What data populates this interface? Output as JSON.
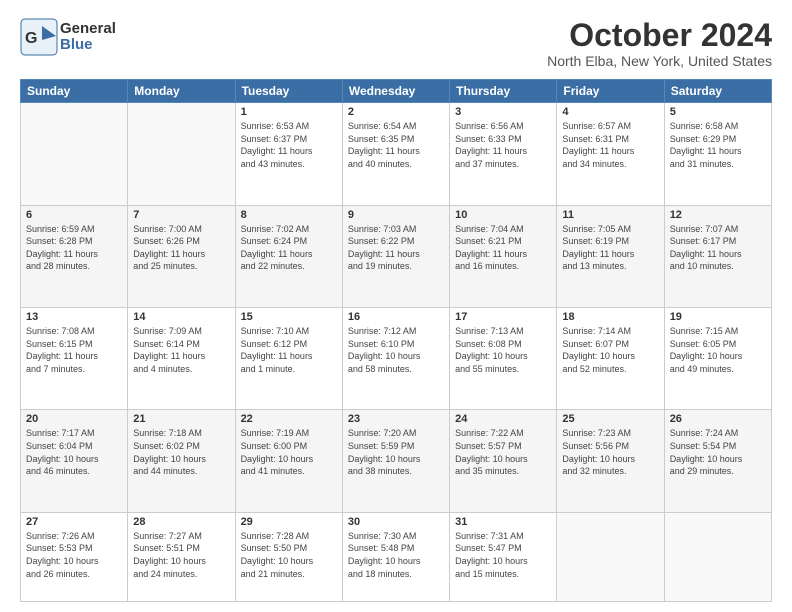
{
  "header": {
    "logo_general": "General",
    "logo_blue": "Blue",
    "month_title": "October 2024",
    "location": "North Elba, New York, United States"
  },
  "days_of_week": [
    "Sunday",
    "Monday",
    "Tuesday",
    "Wednesday",
    "Thursday",
    "Friday",
    "Saturday"
  ],
  "weeks": [
    [
      {
        "num": "",
        "info": ""
      },
      {
        "num": "",
        "info": ""
      },
      {
        "num": "1",
        "info": "Sunrise: 6:53 AM\nSunset: 6:37 PM\nDaylight: 11 hours\nand 43 minutes."
      },
      {
        "num": "2",
        "info": "Sunrise: 6:54 AM\nSunset: 6:35 PM\nDaylight: 11 hours\nand 40 minutes."
      },
      {
        "num": "3",
        "info": "Sunrise: 6:56 AM\nSunset: 6:33 PM\nDaylight: 11 hours\nand 37 minutes."
      },
      {
        "num": "4",
        "info": "Sunrise: 6:57 AM\nSunset: 6:31 PM\nDaylight: 11 hours\nand 34 minutes."
      },
      {
        "num": "5",
        "info": "Sunrise: 6:58 AM\nSunset: 6:29 PM\nDaylight: 11 hours\nand 31 minutes."
      }
    ],
    [
      {
        "num": "6",
        "info": "Sunrise: 6:59 AM\nSunset: 6:28 PM\nDaylight: 11 hours\nand 28 minutes."
      },
      {
        "num": "7",
        "info": "Sunrise: 7:00 AM\nSunset: 6:26 PM\nDaylight: 11 hours\nand 25 minutes."
      },
      {
        "num": "8",
        "info": "Sunrise: 7:02 AM\nSunset: 6:24 PM\nDaylight: 11 hours\nand 22 minutes."
      },
      {
        "num": "9",
        "info": "Sunrise: 7:03 AM\nSunset: 6:22 PM\nDaylight: 11 hours\nand 19 minutes."
      },
      {
        "num": "10",
        "info": "Sunrise: 7:04 AM\nSunset: 6:21 PM\nDaylight: 11 hours\nand 16 minutes."
      },
      {
        "num": "11",
        "info": "Sunrise: 7:05 AM\nSunset: 6:19 PM\nDaylight: 11 hours\nand 13 minutes."
      },
      {
        "num": "12",
        "info": "Sunrise: 7:07 AM\nSunset: 6:17 PM\nDaylight: 11 hours\nand 10 minutes."
      }
    ],
    [
      {
        "num": "13",
        "info": "Sunrise: 7:08 AM\nSunset: 6:15 PM\nDaylight: 11 hours\nand 7 minutes."
      },
      {
        "num": "14",
        "info": "Sunrise: 7:09 AM\nSunset: 6:14 PM\nDaylight: 11 hours\nand 4 minutes."
      },
      {
        "num": "15",
        "info": "Sunrise: 7:10 AM\nSunset: 6:12 PM\nDaylight: 11 hours\nand 1 minute."
      },
      {
        "num": "16",
        "info": "Sunrise: 7:12 AM\nSunset: 6:10 PM\nDaylight: 10 hours\nand 58 minutes."
      },
      {
        "num": "17",
        "info": "Sunrise: 7:13 AM\nSunset: 6:08 PM\nDaylight: 10 hours\nand 55 minutes."
      },
      {
        "num": "18",
        "info": "Sunrise: 7:14 AM\nSunset: 6:07 PM\nDaylight: 10 hours\nand 52 minutes."
      },
      {
        "num": "19",
        "info": "Sunrise: 7:15 AM\nSunset: 6:05 PM\nDaylight: 10 hours\nand 49 minutes."
      }
    ],
    [
      {
        "num": "20",
        "info": "Sunrise: 7:17 AM\nSunset: 6:04 PM\nDaylight: 10 hours\nand 46 minutes."
      },
      {
        "num": "21",
        "info": "Sunrise: 7:18 AM\nSunset: 6:02 PM\nDaylight: 10 hours\nand 44 minutes."
      },
      {
        "num": "22",
        "info": "Sunrise: 7:19 AM\nSunset: 6:00 PM\nDaylight: 10 hours\nand 41 minutes."
      },
      {
        "num": "23",
        "info": "Sunrise: 7:20 AM\nSunset: 5:59 PM\nDaylight: 10 hours\nand 38 minutes."
      },
      {
        "num": "24",
        "info": "Sunrise: 7:22 AM\nSunset: 5:57 PM\nDaylight: 10 hours\nand 35 minutes."
      },
      {
        "num": "25",
        "info": "Sunrise: 7:23 AM\nSunset: 5:56 PM\nDaylight: 10 hours\nand 32 minutes."
      },
      {
        "num": "26",
        "info": "Sunrise: 7:24 AM\nSunset: 5:54 PM\nDaylight: 10 hours\nand 29 minutes."
      }
    ],
    [
      {
        "num": "27",
        "info": "Sunrise: 7:26 AM\nSunset: 5:53 PM\nDaylight: 10 hours\nand 26 minutes."
      },
      {
        "num": "28",
        "info": "Sunrise: 7:27 AM\nSunset: 5:51 PM\nDaylight: 10 hours\nand 24 minutes."
      },
      {
        "num": "29",
        "info": "Sunrise: 7:28 AM\nSunset: 5:50 PM\nDaylight: 10 hours\nand 21 minutes."
      },
      {
        "num": "30",
        "info": "Sunrise: 7:30 AM\nSunset: 5:48 PM\nDaylight: 10 hours\nand 18 minutes."
      },
      {
        "num": "31",
        "info": "Sunrise: 7:31 AM\nSunset: 5:47 PM\nDaylight: 10 hours\nand 15 minutes."
      },
      {
        "num": "",
        "info": ""
      },
      {
        "num": "",
        "info": ""
      }
    ]
  ]
}
